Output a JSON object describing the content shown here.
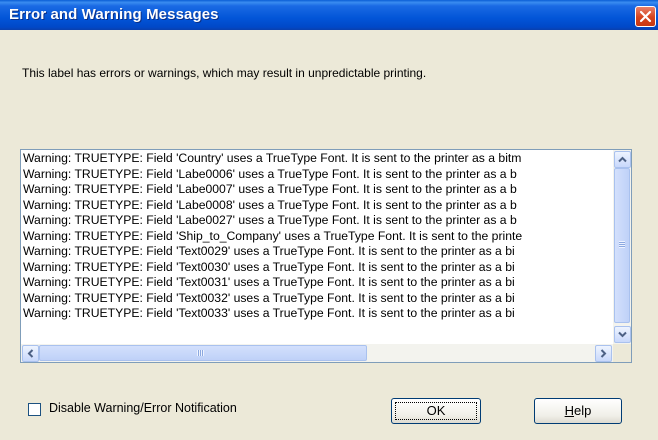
{
  "window": {
    "title": "Error and Warning Messages"
  },
  "message": "This label has errors or warnings, which may result in unpredictable printing.",
  "messages_list": {
    "rows": [
      "Warning: TRUETYPE:  Field 'Country' uses a TrueType Font.  It is sent to the printer as a bitm",
      "Warning: TRUETYPE:  Field 'Labe0006' uses a TrueType Font.  It is sent to the printer as a b",
      "Warning: TRUETYPE:  Field 'Labe0007' uses a TrueType Font.  It is sent to the printer as a b",
      "Warning: TRUETYPE:  Field 'Labe0008' uses a TrueType Font.  It is sent to the printer as a b",
      "Warning: TRUETYPE:  Field 'Labe0027' uses a TrueType Font.  It is sent to the printer as a b",
      "Warning: TRUETYPE:  Field 'Ship_to_Company' uses a TrueType Font.  It is sent to the printe",
      "Warning: TRUETYPE:  Field 'Text0029' uses a TrueType Font.  It is sent to the printer as a bi",
      "Warning: TRUETYPE:  Field 'Text0030' uses a TrueType Font.  It is sent to the printer as a bi",
      "Warning: TRUETYPE:  Field 'Text0031' uses a TrueType Font.  It is sent to the printer as a bi",
      "Warning: TRUETYPE:  Field 'Text0032' uses a TrueType Font.  It is sent to the printer as a bi",
      "Warning: TRUETYPE:  Field 'Text0033' uses a TrueType Font.  It is sent to the printer as a bi"
    ]
  },
  "checkbox": {
    "label": "Disable Warning/Error Notification",
    "checked": false
  },
  "buttons": {
    "ok": "OK",
    "help_first": "H",
    "help_rest": "elp"
  },
  "icons": {
    "close": "close-icon",
    "scroll_up": "chevron-up-icon",
    "scroll_down": "chevron-down-icon",
    "scroll_left": "chevron-left-icon",
    "scroll_right": "chevron-right-icon"
  },
  "colors": {
    "titlebar": "#0255d8",
    "dialog_bg": "#ece9d8",
    "close_button": "#d5431c",
    "listbox_border": "#7f9db9"
  }
}
